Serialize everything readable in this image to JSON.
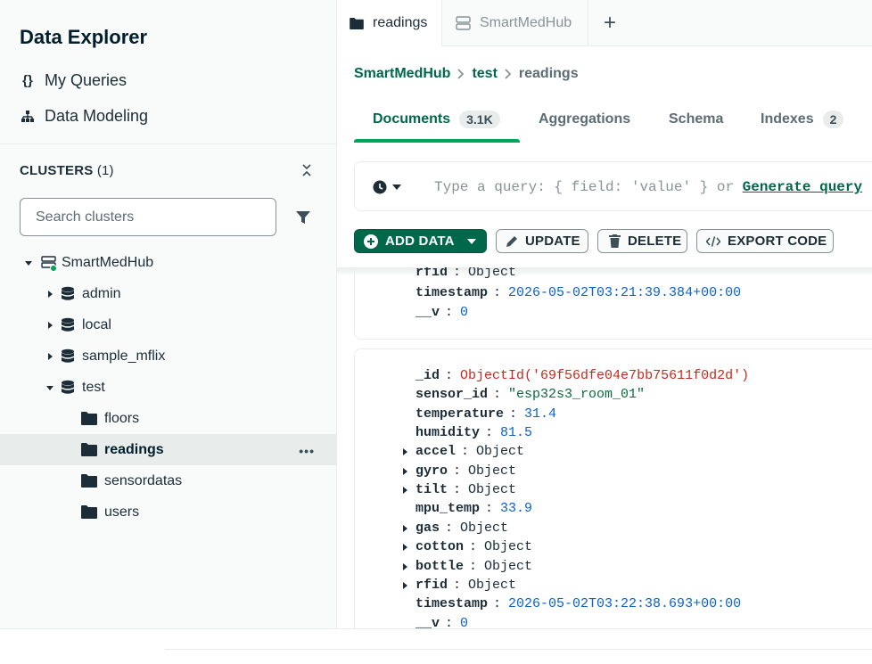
{
  "sidebar": {
    "title": "Data Explorer",
    "nav": [
      {
        "label": "My Queries",
        "icon": "braces-icon"
      },
      {
        "label": "Data Modeling",
        "icon": "diagram-icon"
      }
    ],
    "clusters_label": "CLUSTERS",
    "clusters_count": "(1)",
    "search_placeholder": "Search clusters",
    "tree": {
      "cluster": "SmartMedHub",
      "databases": [
        "admin",
        "local",
        "sample_mflix",
        "test"
      ],
      "collections": [
        "floors",
        "readings",
        "sensordatas",
        "users"
      ],
      "selected": "readings"
    }
  },
  "tabs": [
    {
      "label": "readings",
      "active": true
    },
    {
      "label": "SmartMedHub",
      "active": false
    }
  ],
  "breadcrumb": [
    "SmartMedHub",
    "test",
    "readings"
  ],
  "subtabs": [
    {
      "label": "Documents",
      "badge": "3.1K"
    },
    {
      "label": "Aggregations"
    },
    {
      "label": "Schema"
    },
    {
      "label": "Indexes",
      "badge": "2"
    }
  ],
  "query": {
    "placeholder": "Type a query: { field: 'value' } or",
    "link": "Generate query"
  },
  "actions": {
    "add_data": "ADD DATA",
    "update": "UPDATE",
    "delete": "DELETE",
    "export_code": "EXPORT CODE"
  },
  "doc1": {
    "partial_field": "rfid",
    "partial_value": "Object",
    "timestamp_key": "timestamp",
    "timestamp": "2026-05-02T03:21:39.384+00:00",
    "v_key": "__v",
    "v": "0"
  },
  "doc2": {
    "fields": [
      {
        "key": "_id",
        "value": "ObjectId('69f56dfe04e7bb75611f0d2d')",
        "type": "oid"
      },
      {
        "key": "sensor_id",
        "value": "\"esp32s3_room_01\"",
        "type": "str"
      },
      {
        "key": "temperature",
        "value": "31.4",
        "type": "num"
      },
      {
        "key": "humidity",
        "value": "81.5",
        "type": "num"
      },
      {
        "key": "accel",
        "value": "Object",
        "type": "obj"
      },
      {
        "key": "gyro",
        "value": "Object",
        "type": "obj"
      },
      {
        "key": "tilt",
        "value": "Object",
        "type": "obj"
      },
      {
        "key": "mpu_temp",
        "value": "33.9",
        "type": "num"
      },
      {
        "key": "gas",
        "value": "Object",
        "type": "obj"
      },
      {
        "key": "cotton",
        "value": "Object",
        "type": "obj"
      },
      {
        "key": "bottle",
        "value": "Object",
        "type": "obj"
      },
      {
        "key": "rfid",
        "value": "Object",
        "type": "obj"
      },
      {
        "key": "timestamp",
        "value": "2026-05-02T03:22:38.693+00:00",
        "type": "date"
      },
      {
        "key": "__v",
        "value": "0",
        "type": "num"
      }
    ]
  },
  "colors": {
    "accent": "#00684a",
    "accent_light": "#00a35c"
  }
}
